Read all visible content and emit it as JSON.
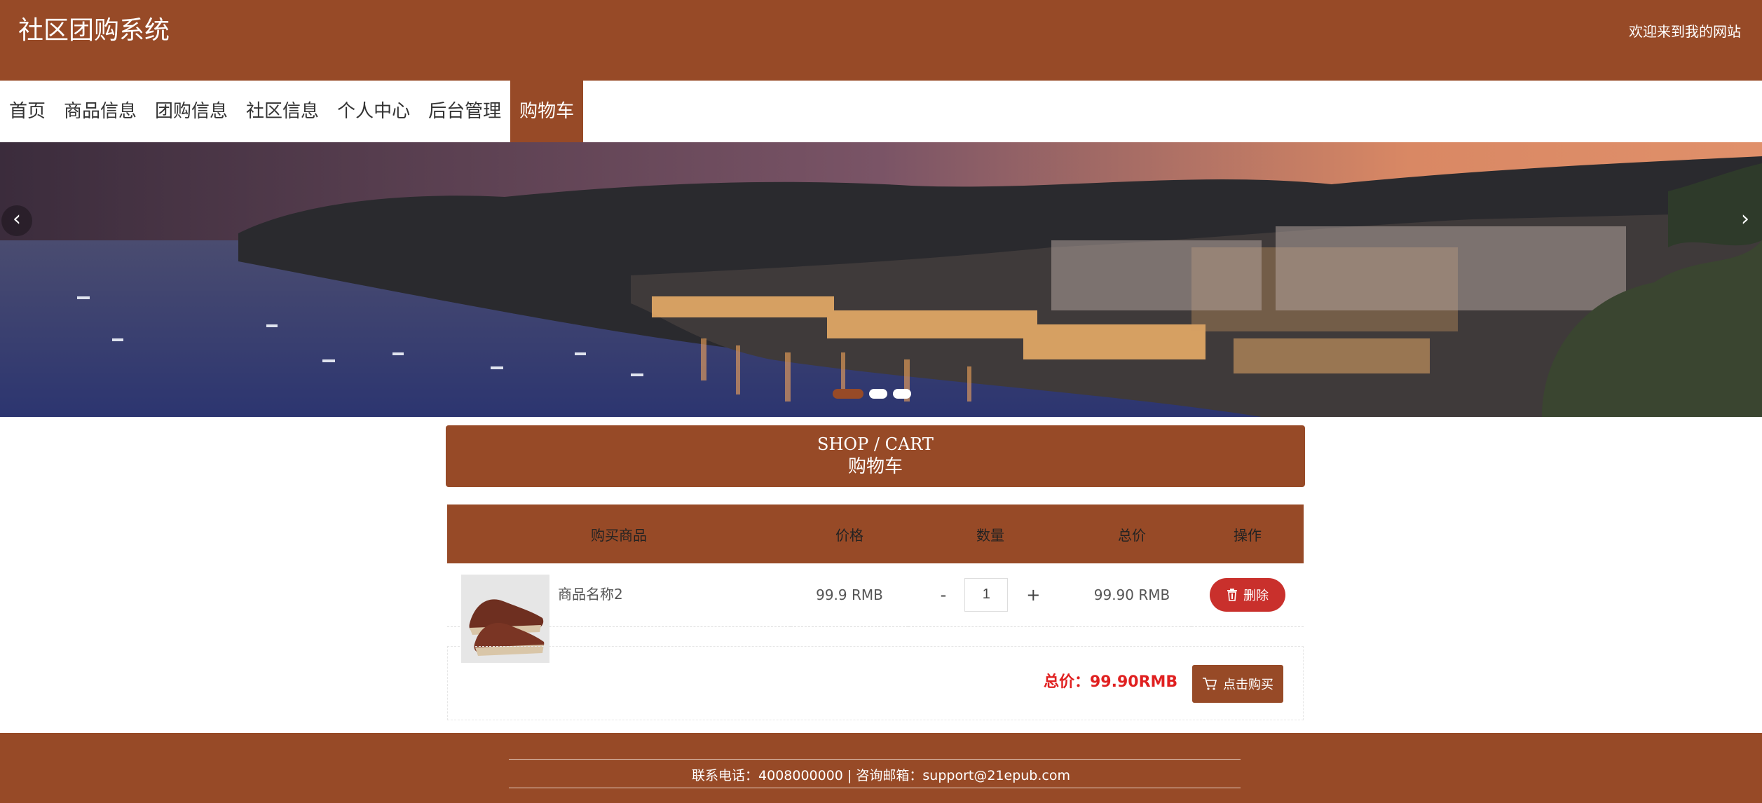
{
  "header": {
    "site_title": "社区团购系统",
    "welcome": "欢迎来到我的网站"
  },
  "nav": {
    "items": [
      "首页",
      "商品信息",
      "团购信息",
      "社区信息",
      "个人中心",
      "后台管理",
      "购物车"
    ],
    "active_index": 6
  },
  "banner": {
    "prev_icon": "chevron-left-icon",
    "next_icon": "chevron-right-icon",
    "slide_count": 3,
    "active_slide": 0
  },
  "cart": {
    "title_en": "SHOP / CART",
    "title_cn": "购物车",
    "columns": [
      "购买商品",
      "价格",
      "数量",
      "总价",
      "操作"
    ],
    "rows": [
      {
        "name": "商品名称2",
        "price": "99.9 RMB",
        "qty_minus": "-",
        "quantity": "1",
        "qty_plus": "+",
        "total": "99.90 RMB",
        "delete_label": "删除"
      }
    ],
    "summary_label": "总价：99.90RMB",
    "buy_label": "点击购买"
  },
  "footer": {
    "text": "联系电话：4008000000 | 咨询邮箱：support@21epub.com"
  },
  "colors": {
    "brand": "#974a27",
    "delete": "#c9302c",
    "total_text": "#e02020"
  }
}
